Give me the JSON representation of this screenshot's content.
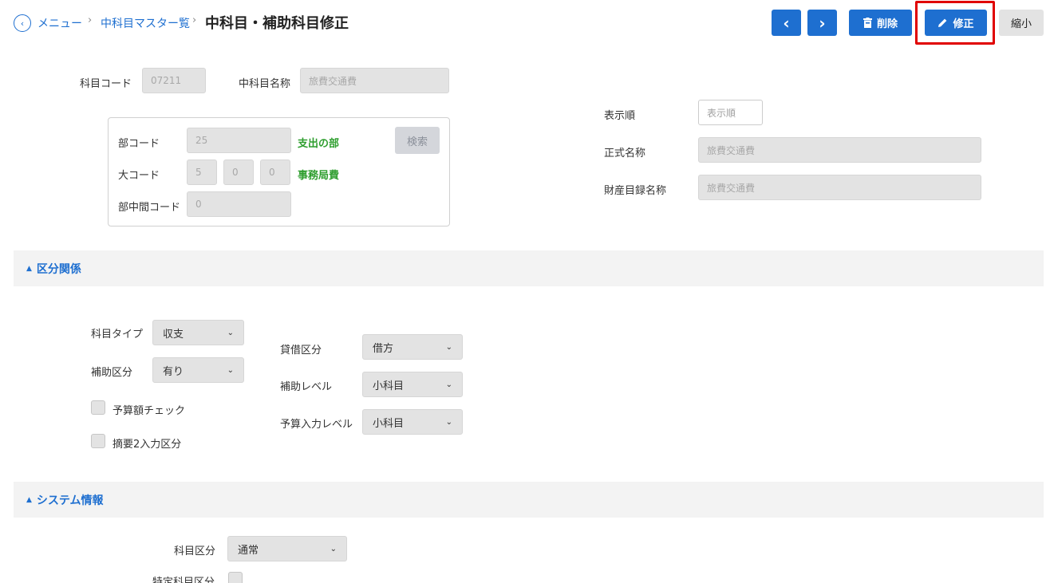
{
  "header": {
    "breadcrumb": [
      {
        "label": "メニュー"
      },
      {
        "label": "中科目マスター覧"
      }
    ],
    "title": "中科目・補助科目修正",
    "prev_icon": "‹",
    "next_icon": "›",
    "delete_label": "削除",
    "edit_label": "修正",
    "shrink_label": "縮小"
  },
  "top_form": {
    "account_code": {
      "label": "科目コード",
      "value": "07211"
    },
    "mid_account_name": {
      "label": "中科目名称",
      "value": "旅費交通費"
    },
    "dept_code": {
      "label": "部コード",
      "value": "25",
      "resolved": "支出の部"
    },
    "search_label": "検索",
    "major_code": {
      "label": "大コード",
      "values": [
        "5",
        "0",
        "0"
      ],
      "resolved": "事務局費"
    },
    "dept_mid_code": {
      "label": "部中間コード",
      "value": "0"
    },
    "display_order": {
      "label": "表示順",
      "placeholder": "表示順"
    },
    "official_name": {
      "label": "正式名称",
      "value": "旅費交通費"
    },
    "inventory_name": {
      "label": "財産目録名称",
      "value": "旅費交通費"
    }
  },
  "section_classification": {
    "title": "区分関係",
    "account_type": {
      "label": "科目タイプ",
      "value": "収支"
    },
    "aux_class": {
      "label": "補助区分",
      "value": "有り"
    },
    "budget_check": {
      "label": "予算額チェック",
      "checked": false
    },
    "summary2": {
      "label": "摘要2入力区分",
      "checked": false
    },
    "debit_credit": {
      "label": "貸借区分",
      "value": "借方"
    },
    "aux_level": {
      "label": "補助レベル",
      "value": "小科目"
    },
    "budget_input_level": {
      "label": "予算入力レベル",
      "value": "小科目"
    }
  },
  "section_system": {
    "title": "システム情報",
    "account_class": {
      "label": "科目区分",
      "value": "通常"
    },
    "special_account_class": {
      "label": "特定科目区分",
      "checked": false
    }
  },
  "colors": {
    "primary": "#1e6fd0",
    "highlight": "#e00000",
    "resolved_text": "#2e9e2e"
  }
}
